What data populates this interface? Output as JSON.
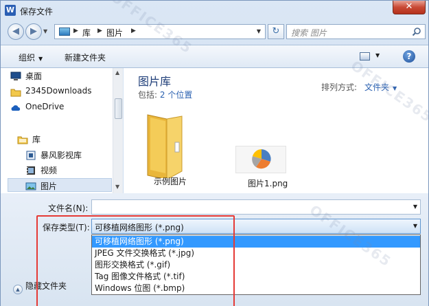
{
  "window": {
    "title": "保存文件",
    "app_icon_letter": "W",
    "close_glyph": "✕"
  },
  "nav": {
    "back_glyph": "◀",
    "forward_glyph": "▶",
    "breadcrumb": [
      "库",
      "图片"
    ],
    "search_placeholder": "搜索 图片",
    "refresh_glyph": "↻"
  },
  "toolbar": {
    "organize_label": "组织",
    "new_folder_label": "新建文件夹",
    "help_glyph": "?"
  },
  "navpane": {
    "items": [
      {
        "label": "桌面",
        "icon": "desktop-icon"
      },
      {
        "label": "2345Downloads",
        "icon": "folder-icon"
      },
      {
        "label": "OneDrive",
        "icon": "cloud-icon"
      },
      {
        "label": "库",
        "icon": "library-icon"
      },
      {
        "label": "暴风影视库",
        "icon": "video-library-icon"
      },
      {
        "label": "视频",
        "icon": "video-icon"
      },
      {
        "label": "图片",
        "icon": "pictures-icon"
      }
    ]
  },
  "content": {
    "library_title": "图片库",
    "includes_prefix": "包括:",
    "includes_link": "2 个位置",
    "arrange_label": "排列方式:",
    "arrange_value": "文件夹",
    "files": [
      {
        "label": "示例图片",
        "icon": "folder-icon"
      },
      {
        "label": "图片1.png",
        "icon": "pie-chart-thumbnail-icon"
      }
    ]
  },
  "form": {
    "filename_label": "文件名(N):",
    "filename_value": "",
    "filetype_label": "保存类型(T):",
    "filetype_value": "可移植网络图形 (*.png)",
    "filetype_options": [
      "可移植网络图形 (*.png)",
      "JPEG 文件交换格式 (*.jpg)",
      "图形交换格式 (*.gif)",
      "Tag 图像文件格式 (*.tif)",
      "Windows 位图 (*.bmp)"
    ],
    "selected_index": 0,
    "hide_folders_label": "隐藏文件夹"
  },
  "colors": {
    "selection": "#3399ff",
    "highlight_box": "#e53935",
    "link": "#2a60b0"
  }
}
